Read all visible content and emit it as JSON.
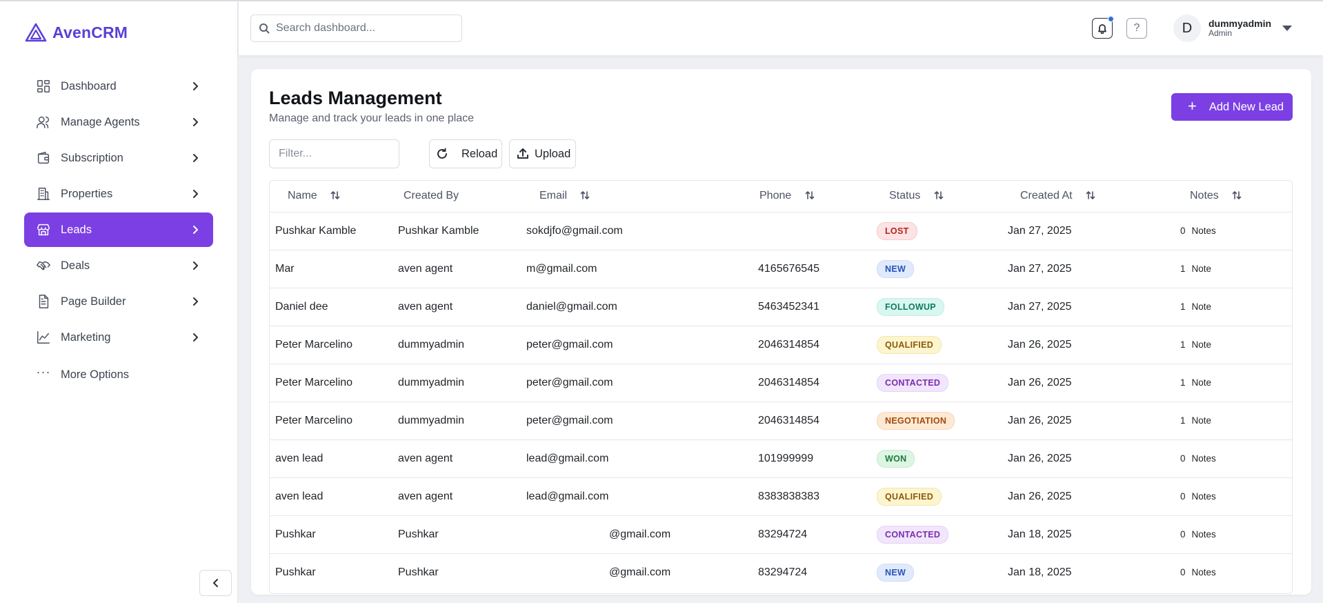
{
  "app": {
    "brand": "AvenCRM",
    "brand_color": "#5b3fd6",
    "accent_color": "#7b3fe4"
  },
  "sidebar": {
    "items": [
      {
        "label": "Dashboard",
        "icon": "dashboard-icon"
      },
      {
        "label": "Manage Agents",
        "icon": "users-icon"
      },
      {
        "label": "Subscription",
        "icon": "wallet-icon"
      },
      {
        "label": "Properties",
        "icon": "building-icon"
      },
      {
        "label": "Leads",
        "icon": "store-icon",
        "active": true
      },
      {
        "label": "Deals",
        "icon": "handshake-icon"
      },
      {
        "label": "Page Builder",
        "icon": "document-icon"
      },
      {
        "label": "Marketing",
        "icon": "line-chart-icon"
      }
    ],
    "more_label": "More Options"
  },
  "header": {
    "search_placeholder": "Search dashboard...",
    "help_label": "?",
    "user": {
      "initial": "D",
      "name": "dummyadmin",
      "role": "Admin"
    }
  },
  "page": {
    "title": "Leads Management",
    "subtitle": "Manage and track your leads in one place",
    "add_button": "Add New Lead",
    "filter_placeholder": "Filter...",
    "reload_label": "Reload",
    "upload_label": "Upload"
  },
  "table": {
    "columns": {
      "name": "Name",
      "created_by": "Created By",
      "email": "Email",
      "phone": "Phone",
      "status": "Status",
      "created_at": "Created At",
      "notes": "Notes"
    },
    "rows": [
      {
        "name": "Pushkar Kamble",
        "created_by": "Pushkar Kamble",
        "email": "sokdjfo@gmail.com",
        "phone": "",
        "status": "LOST",
        "status_class": "lost",
        "created_at": "Jan 27, 2025",
        "notes_count": "0",
        "notes_label": "Notes"
      },
      {
        "name": "Mar",
        "created_by": "aven agent",
        "email": "m@gmail.com",
        "phone": "4165676545",
        "status": "NEW",
        "status_class": "new",
        "created_at": "Jan 27, 2025",
        "notes_count": "1",
        "notes_label": "Note"
      },
      {
        "name": "Daniel dee",
        "created_by": "aven agent",
        "email": "daniel@gmail.com",
        "phone": "5463452341",
        "status": "FOLLOWUP",
        "status_class": "followup",
        "created_at": "Jan 27, 2025",
        "notes_count": "1",
        "notes_label": "Note"
      },
      {
        "name": "Peter Marcelino",
        "created_by": "dummyadmin",
        "email": "peter@gmail.com",
        "phone": "2046314854",
        "status": "QUALIFIED",
        "status_class": "qualified",
        "created_at": "Jan 26, 2025",
        "notes_count": "1",
        "notes_label": "Note"
      },
      {
        "name": "Peter Marcelino",
        "created_by": "dummyadmin",
        "email": "peter@gmail.com",
        "phone": "2046314854",
        "status": "CONTACTED",
        "status_class": "contacted",
        "created_at": "Jan 26, 2025",
        "notes_count": "1",
        "notes_label": "Note"
      },
      {
        "name": "Peter Marcelino",
        "created_by": "dummyadmin",
        "email": "peter@gmail.com",
        "phone": "2046314854",
        "status": "NEGOTIATION",
        "status_class": "negotiation",
        "created_at": "Jan 26, 2025",
        "notes_count": "1",
        "notes_label": "Note"
      },
      {
        "name": "aven lead",
        "created_by": "aven agent",
        "email": "lead@gmail.com",
        "phone": "101999999",
        "status": "WON",
        "status_class": "won",
        "created_at": "Jan 26, 2025",
        "notes_count": "0",
        "notes_label": "Notes"
      },
      {
        "name": "aven lead",
        "created_by": "aven agent",
        "email": "lead@gmail.com",
        "phone": "8383838383",
        "status": "QUALIFIED",
        "status_class": "qualified",
        "created_at": "Jan 26, 2025",
        "notes_count": "0",
        "notes_label": "Notes"
      },
      {
        "name": "Pushkar",
        "created_by": "Pushkar",
        "email": "@gmail.com",
        "phone": "83294724",
        "status": "CONTACTED",
        "status_class": "contacted",
        "created_at": "Jan 18, 2025",
        "notes_count": "0",
        "notes_label": "Notes"
      },
      {
        "name": "Pushkar",
        "created_by": "Pushkar",
        "email": "@gmail.com",
        "phone": "83294724",
        "status": "NEW",
        "status_class": "new",
        "created_at": "Jan 18, 2025",
        "notes_count": "0",
        "notes_label": "Notes"
      }
    ]
  }
}
